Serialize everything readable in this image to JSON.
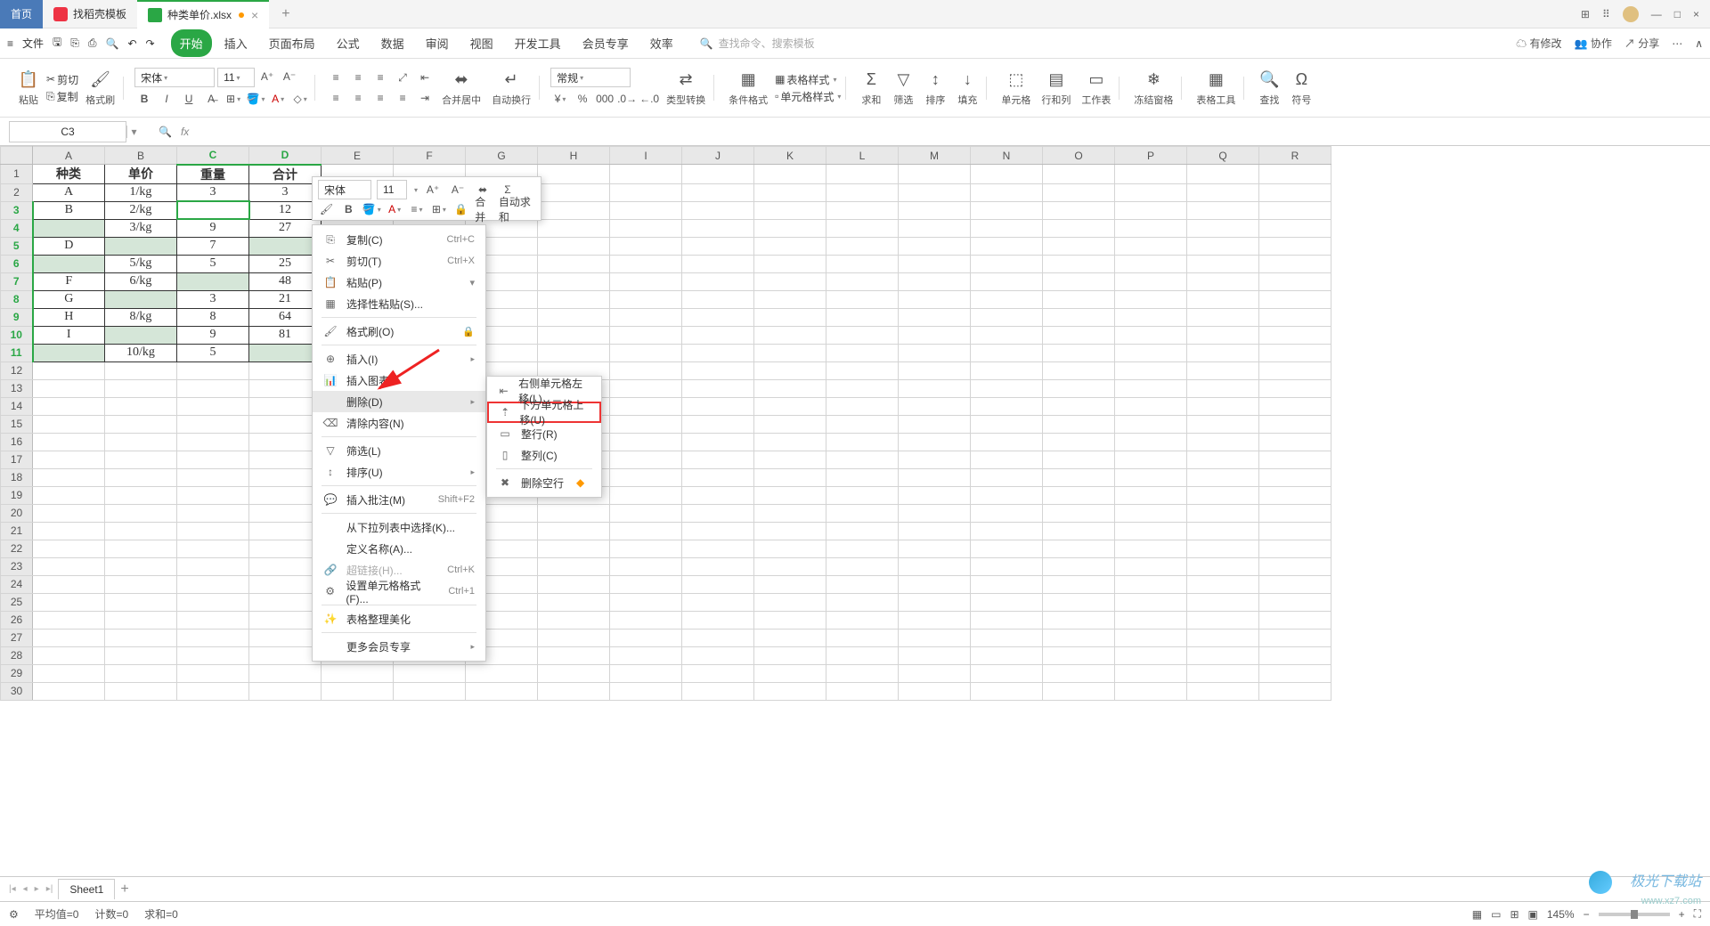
{
  "titlebar": {
    "home_tab": "首页",
    "tab2": "找稻壳模板",
    "tab3": "种类单价.xlsx",
    "plus": "+"
  },
  "window_controls": {
    "min": "—",
    "max": "□",
    "close": "×"
  },
  "menubar": {
    "hamburger": "≡",
    "file": "文件",
    "tabs": [
      "开始",
      "插入",
      "页面布局",
      "公式",
      "数据",
      "审阅",
      "视图",
      "开发工具",
      "会员专享",
      "效率"
    ],
    "search_placeholder": "查找命令、搜索模板",
    "right": {
      "changes": "有修改",
      "coop": "协作",
      "share": "分享"
    }
  },
  "ribbon": {
    "paste": "粘贴",
    "cut": "剪切",
    "copy": "复制",
    "format": "格式刷",
    "font_name": "宋体",
    "font_size": "11",
    "merge": "合并居中",
    "wrap": "自动换行",
    "general": "常规",
    "type_convert": "类型转换",
    "cond_format": "条件格式",
    "table_style": "表格样式",
    "cell_style": "单元格样式",
    "sum": "求和",
    "filter": "筛选",
    "sort": "排序",
    "fill": "填充",
    "cell": "单元格",
    "rowcol": "行和列",
    "sheet": "工作表",
    "freeze": "冻结窗格",
    "table_tool": "表格工具",
    "find": "查找",
    "symbol": "符号"
  },
  "formula": {
    "name_box_value": "C3",
    "fx": "fx"
  },
  "columns": [
    "A",
    "B",
    "C",
    "D",
    "E",
    "F",
    "G",
    "H",
    "I",
    "J",
    "K",
    "L",
    "M",
    "N",
    "O",
    "P",
    "Q",
    "R"
  ],
  "rows_total": 30,
  "table": {
    "headers": [
      "种类",
      "单价",
      "重量",
      "合计"
    ],
    "rows": [
      [
        "A",
        "1/kg",
        "3",
        "3"
      ],
      [
        "B",
        "2/kg",
        "",
        "12"
      ],
      [
        "",
        "3/kg",
        "9",
        "27"
      ],
      [
        "D",
        "",
        "7",
        ""
      ],
      [
        "",
        "5/kg",
        "5",
        "25"
      ],
      [
        "F",
        "6/kg",
        "",
        "48"
      ],
      [
        "G",
        "",
        "3",
        "21"
      ],
      [
        "H",
        "8/kg",
        "8",
        "64"
      ],
      [
        "I",
        "",
        "9",
        "81"
      ],
      [
        "",
        "10/kg",
        "5",
        ""
      ]
    ]
  },
  "mini_toolbar": {
    "font_name": "宋体",
    "font_size": "11",
    "merge": "合并",
    "autosum": "自动求和"
  },
  "context_menu": {
    "copy": "复制(C)",
    "copy_sc": "Ctrl+C",
    "cut": "剪切(T)",
    "cut_sc": "Ctrl+X",
    "paste": "粘贴(P)",
    "paste_special": "选择性粘贴(S)...",
    "format_painter": "格式刷(O)",
    "insert": "插入(I)",
    "insert_chart": "插入图表",
    "delete": "删除(D)",
    "clear": "清除内容(N)",
    "filter": "筛选(L)",
    "sort": "排序(U)",
    "insert_comment": "插入批注(M)",
    "comment_sc": "Shift+F2",
    "from_list": "从下拉列表中选择(K)...",
    "define_name": "定义名称(A)...",
    "hyperlink": "超链接(H)...",
    "hyperlink_sc": "Ctrl+K",
    "format_cells": "设置单元格格式(F)...",
    "format_sc": "Ctrl+1",
    "table_beautify": "表格整理美化",
    "more_vip": "更多会员专享"
  },
  "sub_menu": {
    "shift_left": "右侧单元格左移(L)",
    "shift_up": "下方单元格上移(U)",
    "entire_row": "整行(R)",
    "entire_col": "整列(C)",
    "delete_blank": "删除空行"
  },
  "sheet_tabs": {
    "sheet1": "Sheet1"
  },
  "statusbar": {
    "avg": "平均值=0",
    "count": "计数=0",
    "sum": "求和=0",
    "zoom": "145%"
  },
  "watermark": {
    "name": "极光下载站",
    "url": "www.xz7.com"
  }
}
